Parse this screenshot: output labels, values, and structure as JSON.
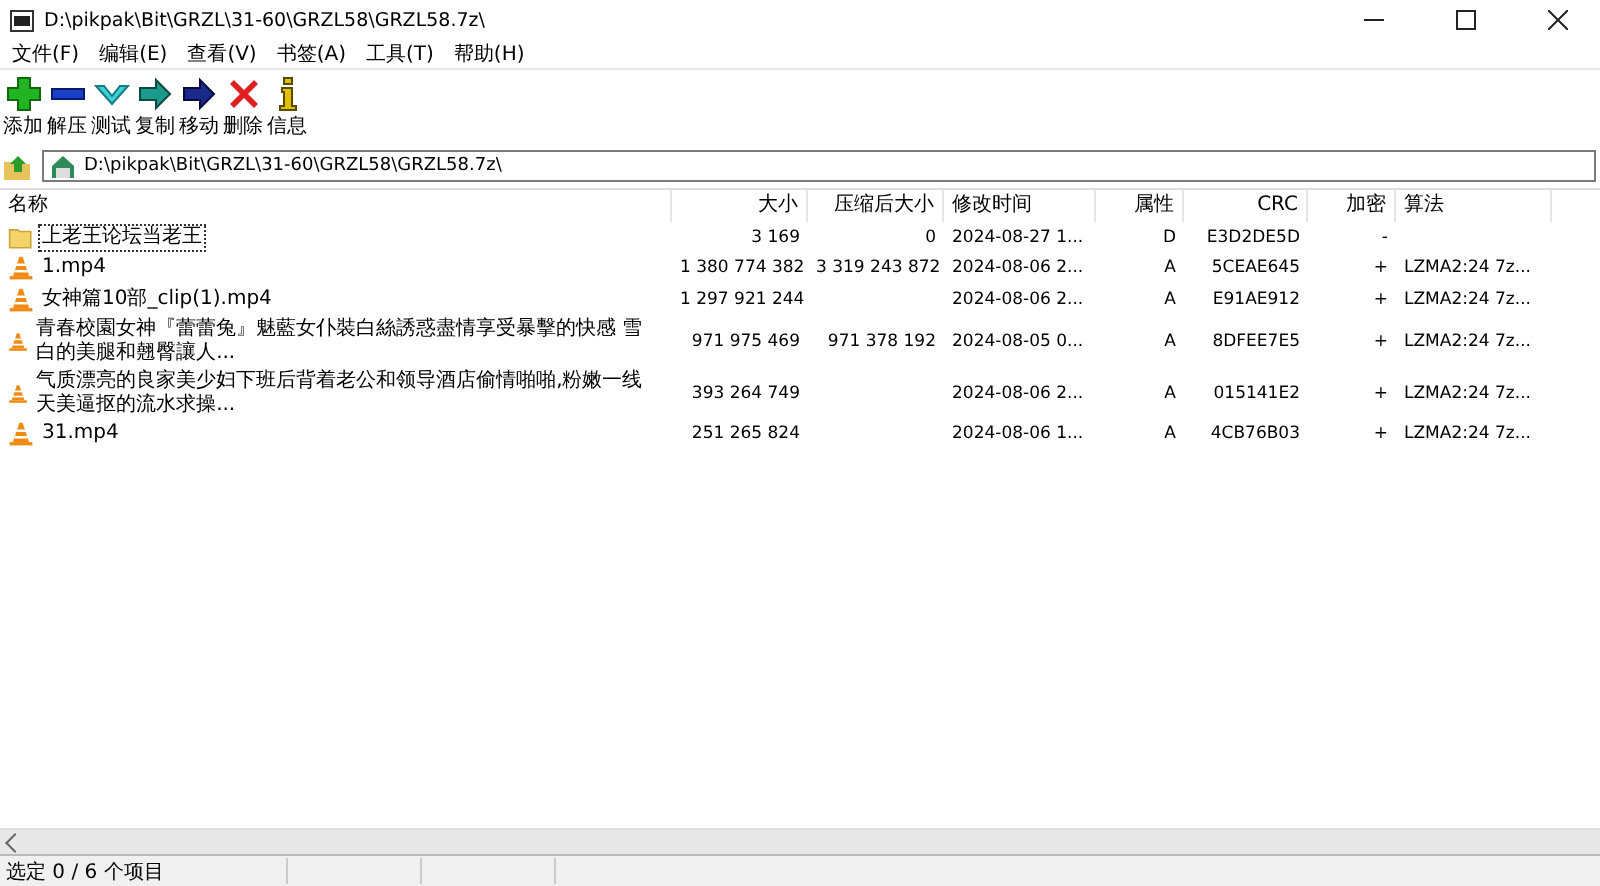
{
  "window": {
    "title": "D:\\pikpak\\Bit\\GRZL\\31-60\\GRZL58\\GRZL58.7z\\"
  },
  "menu": [
    "文件(F)",
    "编辑(E)",
    "查看(V)",
    "书签(A)",
    "工具(T)",
    "帮助(H)"
  ],
  "toolbar": [
    {
      "kind": "add",
      "label": "添加"
    },
    {
      "kind": "extract",
      "label": "解压"
    },
    {
      "kind": "test",
      "label": "测试"
    },
    {
      "kind": "copy",
      "label": "复制"
    },
    {
      "kind": "move",
      "label": "移动"
    },
    {
      "kind": "delete",
      "label": "删除"
    },
    {
      "kind": "info",
      "label": "信息"
    }
  ],
  "address": {
    "value": "D:\\pikpak\\Bit\\GRZL\\31-60\\GRZL58\\GRZL58.7z\\"
  },
  "table": {
    "columns": [
      "名称",
      "大小",
      "压缩后大小",
      "修改时间",
      "属性",
      "CRC",
      "加密",
      "算法"
    ],
    "rows": [
      {
        "kind": "folder",
        "focused": true,
        "cells": [
          "上老王论坛当老王",
          "3 169",
          "0",
          "2024-08-27 1...",
          "D",
          "E3D2DE5D",
          "-",
          ""
        ]
      },
      {
        "kind": "video",
        "focused": false,
        "cells": [
          "1.mp4",
          "1 380 774 382",
          "3 319 243 872",
          "2024-08-06 2...",
          "A",
          "5CEAE645",
          "+",
          "LZMA2:24 7z..."
        ]
      },
      {
        "kind": "video",
        "focused": false,
        "cells": [
          "女神篇10部_clip(1).mp4",
          "1 297 921 244",
          "",
          "2024-08-06 2...",
          "A",
          "E91AE912",
          "+",
          "LZMA2:24 7z..."
        ]
      },
      {
        "kind": "video",
        "focused": false,
        "cells": [
          "青春校園女神『蕾蕾兔』魅藍女仆裝白絲誘惑盡情享受暴擊的快感 雪白的美腿和翹臀讓人...",
          "971 975 469",
          "971 378 192",
          "2024-08-05 0...",
          "A",
          "8DFEE7E5",
          "+",
          "LZMA2:24 7z..."
        ]
      },
      {
        "kind": "video",
        "focused": false,
        "cells": [
          "气质漂亮的良家美少妇下班后背着老公和领导酒店偷情啪啪,粉嫩一线天美逼抠的流水求操...",
          "393 264 749",
          "",
          "2024-08-06 2...",
          "A",
          "015141E2",
          "+",
          "LZMA2:24 7z..."
        ]
      },
      {
        "kind": "video",
        "focused": false,
        "cells": [
          "31.mp4",
          "251 265 824",
          "",
          "2024-08-06 1...",
          "A",
          "4CB76B03",
          "+",
          "LZMA2:24 7z..."
        ]
      }
    ]
  },
  "status_bar": "选定 0 / 6 个项目"
}
